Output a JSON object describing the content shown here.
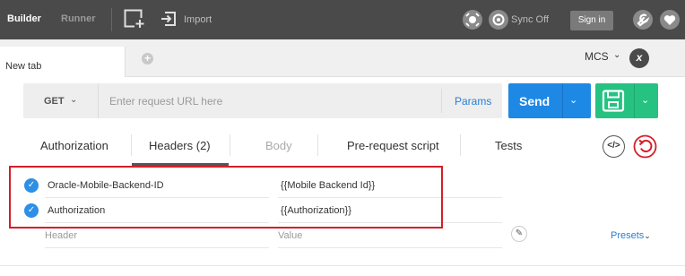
{
  "toolbar": {
    "builder": "Builder",
    "runner": "Runner",
    "import": "Import",
    "sync": "Sync Off",
    "signin": "Sign in",
    "icons": [
      "new-window-icon",
      "import-icon",
      "satellite-icon",
      "sync-icon",
      "wrench-icon",
      "heart-icon"
    ]
  },
  "tabs": {
    "current": "New tab",
    "add_icon": "+"
  },
  "environment": {
    "selected": "MCS",
    "chevron": "⌄",
    "clear": "x"
  },
  "request": {
    "method": "GET",
    "method_chevron": "⌄",
    "url_value": "",
    "url_placeholder": "Enter request URL here",
    "params": "Params",
    "send": "Send",
    "send_chevron": "⌄",
    "save_chevron": "⌄"
  },
  "subtabs": [
    {
      "label": "Authorization",
      "active": false
    },
    {
      "label": "Headers (2)",
      "active": true
    },
    {
      "label": "Body",
      "active": false,
      "disabled": true
    },
    {
      "label": "Pre-request script",
      "active": false
    },
    {
      "label": "Tests",
      "active": false
    }
  ],
  "subtab_icons": {
    "code": "</>",
    "reset": "reset"
  },
  "headers": [
    {
      "enabled": true,
      "key": "Oracle-Mobile-Backend-ID",
      "value": "{{Mobile Backend Id}}"
    },
    {
      "enabled": true,
      "key": "Authorization",
      "value": "{{Authorization}}"
    }
  ],
  "new_header": {
    "key_placeholder": "Header",
    "value_placeholder": "Value"
  },
  "presets": "Presets",
  "presets_chevron": "⌄",
  "colors": {
    "toolbar": "#4a4a4a",
    "send": "#1e88e5",
    "save": "#26c281",
    "highlight": "#d3202a",
    "link": "#2a7ed6"
  }
}
